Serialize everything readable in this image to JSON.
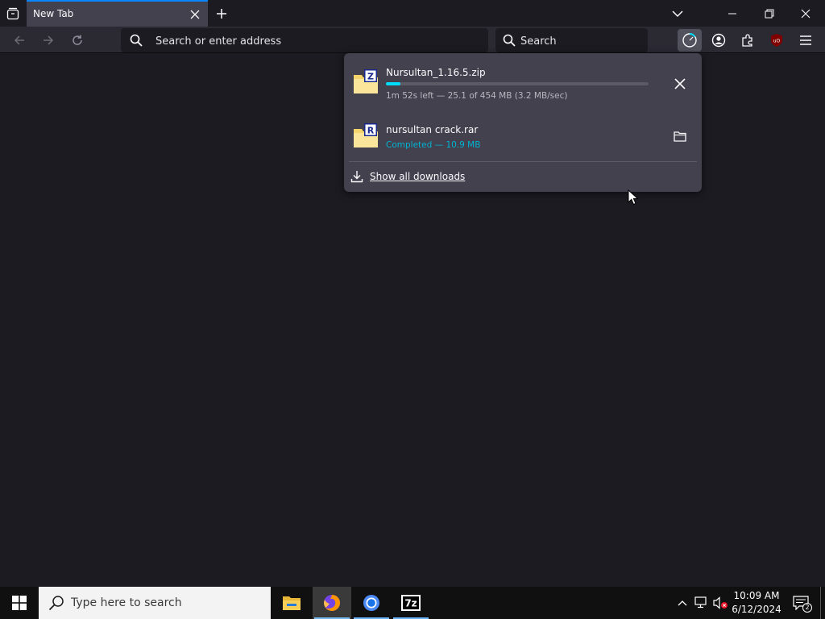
{
  "browser": {
    "tab": {
      "title": "New Tab"
    },
    "urlbar": {
      "placeholder": "Search or enter address"
    },
    "searchbar": {
      "placeholder": "Search"
    }
  },
  "downloads": {
    "items": [
      {
        "filename": "Nursultan_1.16.5.zip",
        "status": "1m 52s left — 25.1 of 454 MB (3.2 MB/sec)",
        "icon_letter": "Z",
        "progress": 0.055,
        "state": "downloading"
      },
      {
        "filename": "nursultan crack.rar",
        "status": "Completed — 10.9 MB",
        "icon_letter": "R",
        "state": "completed"
      }
    ],
    "show_all_label": "Show all downloads"
  },
  "taskbar": {
    "search_placeholder": "Type here to search",
    "clock": {
      "time": "10:09 AM",
      "date": "6/12/2024"
    },
    "notification_count": "2",
    "apps": [
      "file-explorer",
      "firefox",
      "chrome",
      "7-zip"
    ],
    "sevenzip_label": "7z",
    "ublock_label": "uO"
  },
  "colors": {
    "accent": "#0a84ff",
    "progress": "#00ddff",
    "completed_text": "#00b3d4",
    "panel_bg": "#42414d",
    "page_bg": "#1c1b22"
  }
}
